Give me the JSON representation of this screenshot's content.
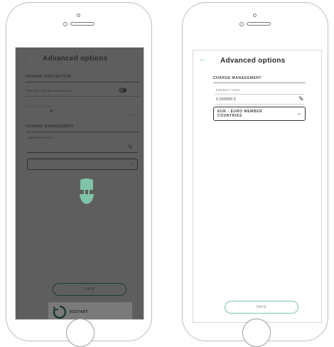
{
  "left": {
    "title": "Advanced options",
    "back_icon": "arrow-left",
    "charge_protection": {
      "heading": "CHARGE PROTECTION",
      "autolock_label": "PROTECTION BY AUTOLOCK",
      "autolock_time_label": "AUTOLOCK TIME",
      "autolock_time_max": "MAX"
    },
    "charge_management": {
      "heading": "CHARGE MANAGEMENT",
      "energy_cost_label": "ENERGY COST"
    },
    "save_label": "SAVE",
    "restart_label": "RESTART",
    "overlay_icon": "plug-icon"
  },
  "right": {
    "title": "Advanced options",
    "back_icon": "arrow-left",
    "section_heading": "CHARGE MANAGEMENT",
    "energy_cost_label": "ENERGY COST",
    "energy_cost_value": "0.200000 €",
    "currency_selected": "EUR - EURO MEMBER COUNTRIES",
    "save_label": "SAVE"
  },
  "colors": {
    "accent": "#7fc4a8",
    "overlay": "#5e5e5e",
    "phone_border": "#bdbdbd"
  }
}
